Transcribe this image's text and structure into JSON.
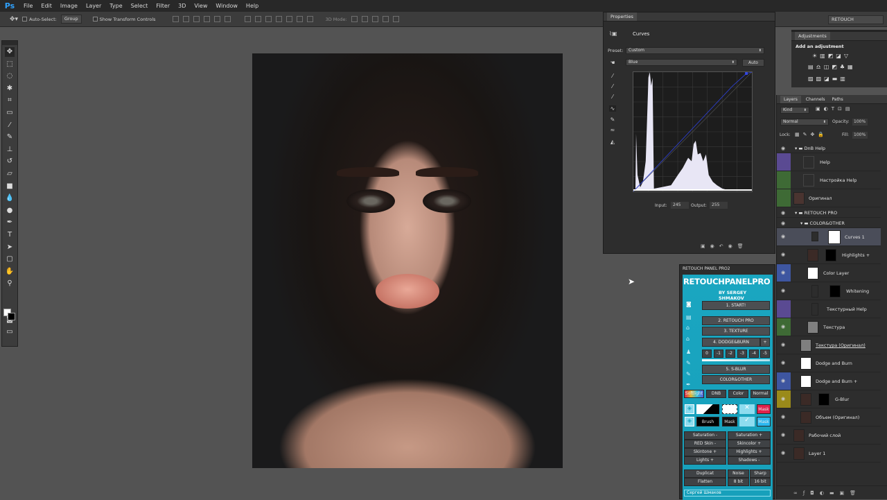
{
  "app": {
    "logo": "Ps"
  },
  "menu": [
    "File",
    "Edit",
    "Image",
    "Layer",
    "Type",
    "Select",
    "Filter",
    "3D",
    "View",
    "Window",
    "Help"
  ],
  "options": {
    "auto_select_label": "Auto-Select:",
    "auto_select_value": "Group",
    "transform_label": "Show Transform Controls",
    "mode_3d": "3D Mode:",
    "workspace": "RETOUCH"
  },
  "properties": {
    "title": "Properties",
    "panel_name": "Curves",
    "preset_label": "Preset:",
    "preset_value": "Custom",
    "channel": "Blue",
    "auto": "Auto",
    "input_label": "Input:",
    "input_value": "245",
    "output_label": "Output:",
    "output_value": "255"
  },
  "adjustments": {
    "title": "Adjustments",
    "subtitle": "Add an adjustment"
  },
  "layers_panel": {
    "tabs": [
      "Layers",
      "Channels",
      "Paths"
    ],
    "kind": "Kind",
    "blend": "Normal",
    "opacity_label": "Opacity:",
    "opacity": "100%",
    "lock_label": "Lock:",
    "fill_label": "Fill:",
    "fill": "100%"
  },
  "layers": [
    {
      "name": "DnB Help",
      "type": "group"
    },
    {
      "name": "Help",
      "type": "adj"
    },
    {
      "name": "Настройка Help",
      "type": "adj"
    },
    {
      "name": "Оригинал",
      "type": "photo"
    },
    {
      "name": "RETOUCH PRO",
      "type": "group"
    },
    {
      "name": "COLOR&OTHER",
      "type": "group"
    },
    {
      "name": "Curves 1",
      "type": "curves"
    },
    {
      "name": "Highlights +",
      "type": "photo"
    },
    {
      "name": "Color Layer",
      "type": "white"
    },
    {
      "name": "Whitening",
      "type": "adj"
    },
    {
      "name": "Текстурный Help",
      "type": "adj"
    },
    {
      "name": "Текстура",
      "type": "gray"
    },
    {
      "name": "Текстура (Оригинал)",
      "type": "gray"
    },
    {
      "name": "Dodge and Burn",
      "type": "white"
    },
    {
      "name": "Dodge and Burn +",
      "type": "white"
    },
    {
      "name": "G-Blur",
      "type": "photo"
    },
    {
      "name": "Объем (Оригинал)",
      "type": "photo"
    },
    {
      "name": "Рабочий слой",
      "type": "photo"
    },
    {
      "name": "Layer 1",
      "type": "photo"
    }
  ],
  "retouch": {
    "title": "RETOUCH PANEL PRO2",
    "brand": "RETOUCHPANELPRO",
    "author": "BY SERGEY SHMAKOV",
    "steps": [
      "1. START!",
      "2. RETOUCH PRO",
      "3. TEXTURE",
      "4. DODGE&BURN",
      "5. S-BLUR",
      "COLOR&OTHER"
    ],
    "plus": "+",
    "levels": [
      "0",
      "-1",
      "-2",
      "-3",
      "-4",
      "-5"
    ],
    "modes": [
      "Softlight",
      "DNB",
      "Color",
      "Normal"
    ],
    "mask": "Mask",
    "brush": "Brush",
    "adj_left": [
      "Saturation -",
      "RED Skin -",
      "Skintone +",
      "Lights +"
    ],
    "adj_right": [
      "Saturation +",
      "Skincolor +",
      "Highlights +",
      "Shadows -"
    ],
    "util": [
      "Duplicat",
      "Noise",
      "Sharp",
      "Flatten",
      "8 bit",
      "16 bit"
    ],
    "footer": "Сергей Шмаков"
  },
  "colors": {
    "accent": "#2fa2ff",
    "panel_cyan": "#1aa6c1",
    "selected_layer": "#4a4d59"
  }
}
